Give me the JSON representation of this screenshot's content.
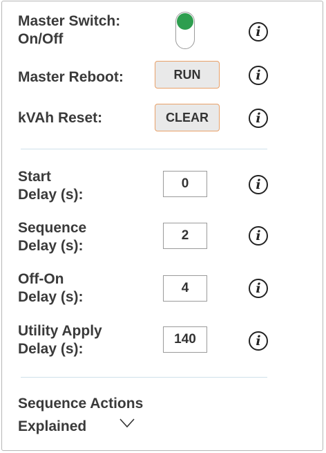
{
  "master_switch": {
    "label": "Master Switch:\nOn/Off",
    "state": "on"
  },
  "master_reboot": {
    "label": "Master Reboot:",
    "button": "RUN"
  },
  "kvah_reset": {
    "label": "kVAh Reset:",
    "button": "CLEAR"
  },
  "delays": [
    {
      "label": "Start\nDelay (s):",
      "value": "0"
    },
    {
      "label": "Sequence\nDelay (s):",
      "value": "2"
    },
    {
      "label": "Off-On\nDelay (s):",
      "value": "4"
    },
    {
      "label": "Utility Apply\nDelay (s):",
      "value": "140"
    }
  ],
  "sequence_actions": {
    "label": "Sequence Actions\nExplained"
  },
  "info_glyph": "i",
  "colors": {
    "toggle_on": "#2e9e4f",
    "button_border": "#e8a068",
    "button_bg": "#e9e9e9",
    "divider": "#cfe0ea"
  },
  "icons": {
    "info": "info-circle-icon",
    "expand": "chevron-down-icon"
  }
}
